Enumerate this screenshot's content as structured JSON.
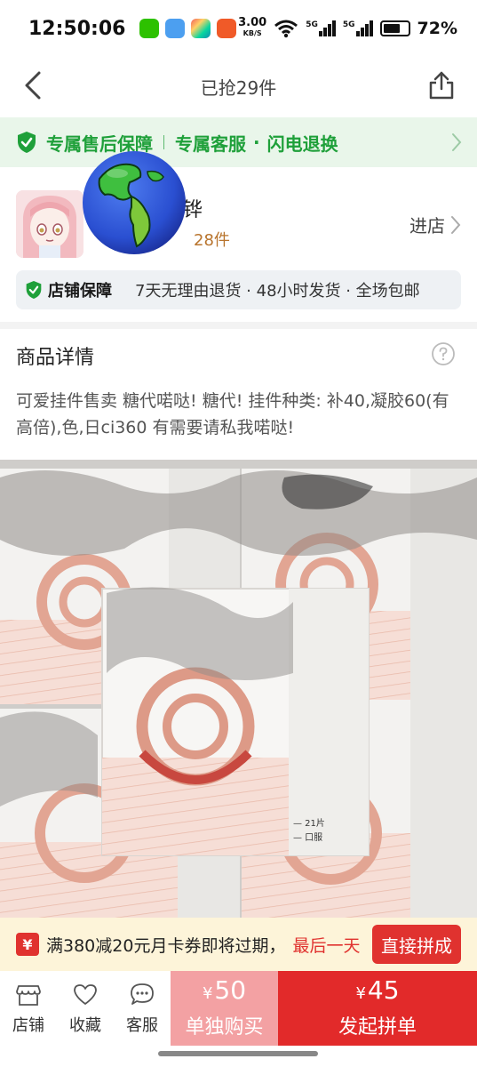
{
  "status_bar": {
    "time": "12:50:06",
    "net_speed_value": "3.00",
    "net_speed_unit": "KB/S",
    "signal_1": "5G",
    "signal_2": "5G",
    "battery": "72%",
    "battery_level": 0.72,
    "app_icons": [
      "wechat-icon",
      "cloud-app-icon",
      "photos-app-icon",
      "shop-app-icon"
    ]
  },
  "nav": {
    "title": "已抢29件"
  },
  "guarantee_banner": {
    "item1": "专属售后保障",
    "item2": "专属客服",
    "item3": "闪电退换",
    "color": "#1fa03a"
  },
  "shop": {
    "name_fragment": "铧",
    "sold_fragment": "28件",
    "enter_label": "进店",
    "guarantee_label": "店铺保障",
    "guarantee_desc": "7天无理由退货 · 48小时发货 · 全场包邮"
  },
  "detail": {
    "title": "商品详情",
    "text": "可爱挂件售卖 糖代喏哒! 糖代! 挂件种类: 补40,凝胶60(有高倍),色,日ci360 有需要请私我喏哒!"
  },
  "product_image": {
    "box_label_1": "— 21片",
    "box_label_2": "— 口服",
    "accent_color": "#d9867a"
  },
  "coupon": {
    "icon": "¥",
    "message": "满380减20元月卡券即将过期，",
    "urgent": "最后一天",
    "button": "直接拼成"
  },
  "bottom_bar": {
    "store": "店铺",
    "favorite": "收藏",
    "service": "客服",
    "single_currency": "¥",
    "single_price": "50",
    "single_label": "单独购买",
    "group_currency": "¥",
    "group_price": "45",
    "group_label": "发起拼单",
    "brand_red": "#e22a2a"
  }
}
